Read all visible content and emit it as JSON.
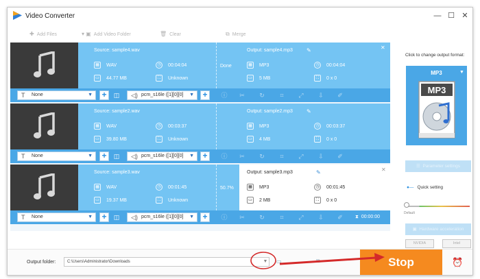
{
  "window": {
    "title": "Video Converter",
    "controls": {
      "minimize": "—",
      "maximize": "☐",
      "close": "✕"
    }
  },
  "toolbar": {
    "add_files": "Add Files",
    "add_video_folder": "Add Video Folder",
    "clear": "Clear",
    "merge": "Merge"
  },
  "tasks": [
    {
      "source": "Source: sample4.wav",
      "src_format": "WAV",
      "src_duration": "00:04:04",
      "src_size": "44.77 MB",
      "src_resolution": "Unknown",
      "status": "Done",
      "output": "Output: sample4.mp3",
      "out_format": "MP3",
      "out_duration": "00:04:04",
      "out_size": "5 MB",
      "out_resolution": "0 x 0",
      "subtitle": "None",
      "audio_track": "pcm_s16le ([1][0][0]"
    },
    {
      "source": "Source: sample2.wav",
      "src_format": "WAV",
      "src_duration": "00:03:37",
      "src_size": "39.80 MB",
      "src_resolution": "Unknown",
      "status": "",
      "output": "Output: sample2.mp3",
      "out_format": "MP3",
      "out_duration": "00:03:37",
      "out_size": "4 MB",
      "out_resolution": "0 x 0",
      "subtitle": "None",
      "audio_track": "pcm_s16le ([1][0][0]"
    },
    {
      "source": "Source: sample3.wav",
      "src_format": "WAV",
      "src_duration": "00:01:45",
      "src_size": "19.37 MB",
      "src_resolution": "Unknown",
      "status": "50.7%",
      "output": "Output: sample3.mp3",
      "out_format": "MP3",
      "out_duration": "00:01:45",
      "out_size": "2 MB",
      "out_resolution": "0 x 0",
      "subtitle": "None",
      "audio_track": "pcm_s16le ([1][0][0]",
      "elapsed": "00:00:00"
    }
  ],
  "side_panel": {
    "hint": "Click to change output format:",
    "format": "MP3",
    "parameter_settings": "Parameter settings",
    "quick_setting": "Quick setting",
    "slider_label": "Default",
    "hardware_acceleration": "Hardware acceleration",
    "chip_nvidia": "NVIDIA",
    "chip_intel": "Intel"
  },
  "bottom": {
    "output_folder_label": "Output folder:",
    "output_folder_value": "C:\\Users\\Administrator\\Downloads",
    "stop_label": "Stop"
  },
  "colors": {
    "row_blue": "#74c4f3",
    "bar_blue": "#4aa7e6",
    "stop_orange": "#f58a1f",
    "annotation_red": "#d42a2a"
  }
}
